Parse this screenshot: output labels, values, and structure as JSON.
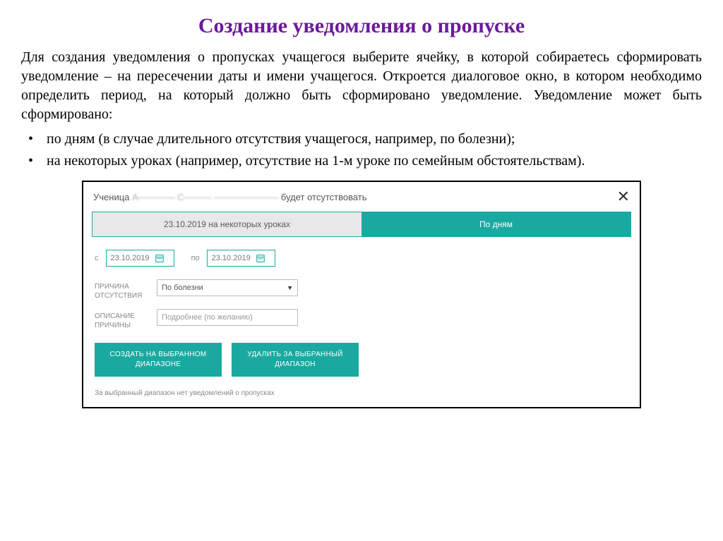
{
  "title": "Создание уведомления о пропуске",
  "paragraph": "Для создания уведомления о пропусках учащегося выберите ячейку, в которой собираетесь сформировать уведомление – на пересечении даты и имени учащегося. Откроется диалоговое окно, в котором необходимо определить период, на который должно быть сформировано уведомление. Уведомление может быть сформировано:",
  "bullets": {
    "b1": "по дням (в случае длительного отсутствия учащегося, например, по болезни);",
    "b2": "на некоторых уроках (например, отсутствие на 1-м уроке по семейным обстоятельствам)."
  },
  "dialog": {
    "header_prefix": "Ученица ",
    "header_name_obscured": "А———— С——— ———————",
    "header_suffix": " будет отсутствовать",
    "tabs": {
      "lessons": "23.10.2019 на некоторых уроках",
      "days": "По дням"
    },
    "dates": {
      "from_label": "с",
      "from_value": "23.10.2019",
      "to_label": "по",
      "to_value": "23.10.2019"
    },
    "reason": {
      "label": "ПРИЧИНА ОТСУТСТВИЯ",
      "value": "По болезни"
    },
    "description": {
      "label": "ОПИСАНИЕ ПРИЧИНЫ",
      "placeholder": "Подробнее (по желанию)"
    },
    "buttons": {
      "create": "СОЗДАТЬ НА ВЫБРАННОМ ДИАПАЗОНЕ",
      "delete": "УДАЛИТЬ ЗА ВЫБРАННЫЙ ДИАПАЗОН"
    },
    "footer": "За выбранный диапазон нет уведомлений о пропусках"
  }
}
